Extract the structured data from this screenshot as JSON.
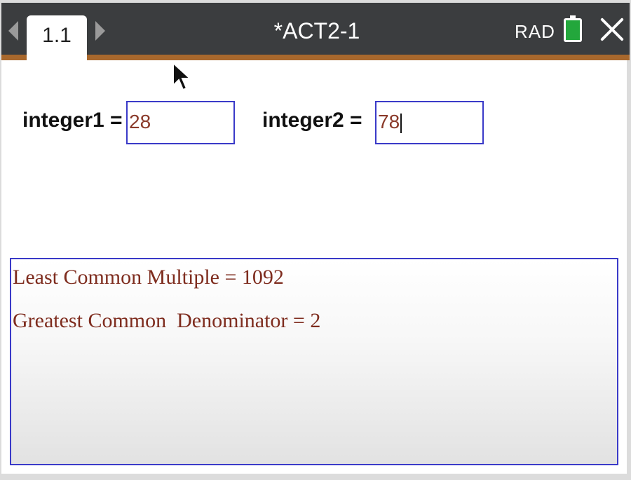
{
  "header": {
    "tab_label": "1.1",
    "document_title": "*ACT2-1",
    "angle_mode": "RAD",
    "colors": {
      "bar": "#3b3d3f",
      "accent": "#a8682d",
      "battery": "#23a73c"
    }
  },
  "inputs": {
    "integer1": {
      "label": "integer1 =",
      "value": "28"
    },
    "integer2": {
      "label": "integer2 =",
      "value": "78"
    }
  },
  "results": {
    "lcm_line": "Least Common Multiple = 1092",
    "gcd_line": "Greatest Common  Denominator = 2",
    "colors": {
      "text": "#7e2c1e",
      "border": "#3a3ac8"
    }
  },
  "icons": [
    "nav-left-icon",
    "nav-right-icon",
    "battery-icon",
    "close-icon",
    "mouse-pointer-icon"
  ]
}
